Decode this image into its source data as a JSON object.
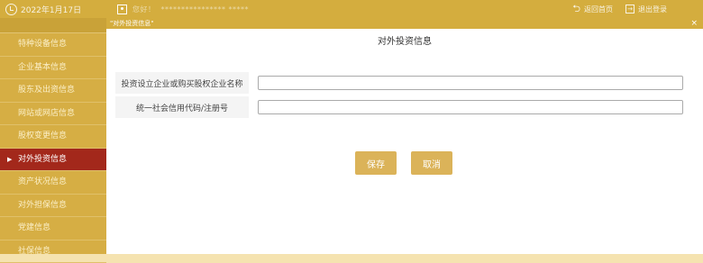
{
  "header": {
    "date": "2022年1月17日",
    "greeting": "您好！",
    "user_info": "**************** *****",
    "return_label": "返回首页",
    "logout_label": "退出登录"
  },
  "sidebar": {
    "items": [
      {
        "label": "特种设备信息"
      },
      {
        "label": "企业基本信息"
      },
      {
        "label": "股东及出资信息"
      },
      {
        "label": "网站或网店信息"
      },
      {
        "label": "股权变更信息"
      },
      {
        "label": "对外投资信息",
        "active": true
      },
      {
        "label": "资产状况信息"
      },
      {
        "label": "对外担保信息"
      },
      {
        "label": "党建信息"
      },
      {
        "label": "社保信息"
      }
    ]
  },
  "modal": {
    "window_title": "\"对外投资信息\"",
    "close_glyph": "×",
    "heading": "对外投资信息",
    "fields": [
      {
        "label": "投资设立企业或购买股权企业名称",
        "value": "",
        "placeholder": ""
      },
      {
        "label": "统一社会信用代码/注册号",
        "value": "",
        "placeholder": ""
      }
    ],
    "save_label": "保存",
    "cancel_label": "取消"
  },
  "colors": {
    "header_bg": "#d4ad3e",
    "sidebar_bg": "#d6ae44",
    "active_item_bg": "#a3281b",
    "button_bg": "#dbb359"
  }
}
